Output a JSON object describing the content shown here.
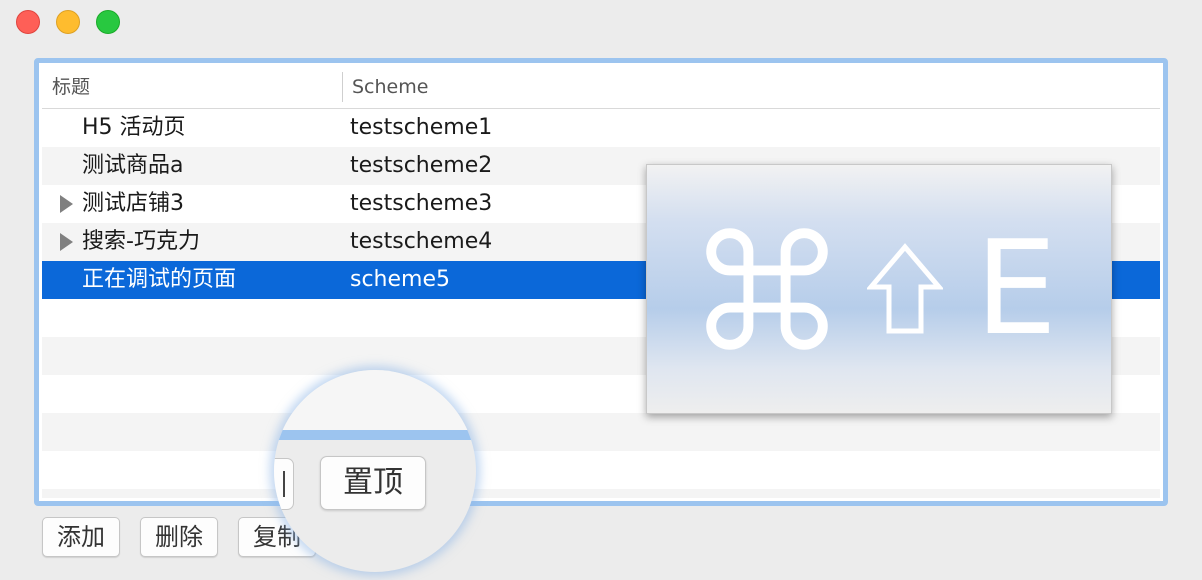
{
  "window": {
    "traffic_lights": [
      "close",
      "minimize",
      "maximize"
    ]
  },
  "table": {
    "columns": [
      "标题",
      "Scheme"
    ],
    "rows": [
      {
        "title": "H5 活动页",
        "scheme": "testscheme1",
        "expandable": false,
        "selected": false
      },
      {
        "title": "测试商品a",
        "scheme": "testscheme2",
        "expandable": false,
        "selected": false
      },
      {
        "title": "测试店铺3",
        "scheme": "testscheme3",
        "expandable": true,
        "selected": false
      },
      {
        "title": "搜索-巧克力",
        "scheme": "testscheme4",
        "expandable": true,
        "selected": false
      },
      {
        "title": "正在调试的页面",
        "scheme": "scheme5",
        "expandable": false,
        "selected": true
      }
    ]
  },
  "buttons": {
    "add": "添加",
    "delete": "删除",
    "copy": "复制",
    "pin_top": "置顶"
  },
  "shortcut_hud": {
    "keys": [
      "command-icon",
      "shift-icon",
      "E"
    ],
    "letter": "E"
  },
  "colors": {
    "selection": "#0b68d9",
    "focus_ring": "#9cc4ef",
    "close": "#fe5f57",
    "minimize": "#febc2e",
    "maximize": "#28c840"
  }
}
